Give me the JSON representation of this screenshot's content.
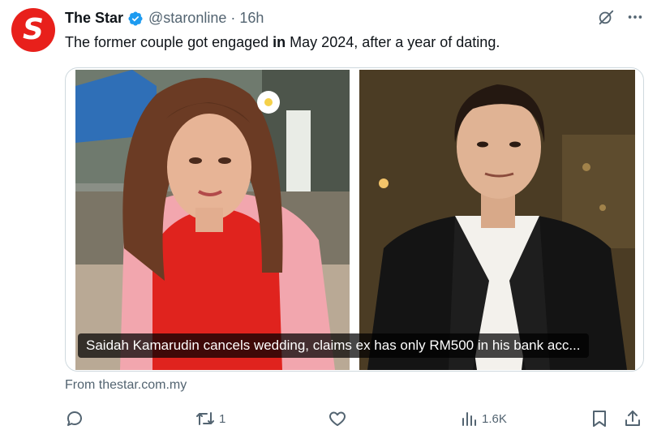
{
  "tweet": {
    "avatar_letter": "S",
    "author_name": "The Star",
    "handle": "@staronline",
    "separator": "·",
    "time": "16h",
    "text_before": "The former couple got engaged ",
    "text_bold": "in",
    "text_after": " May 2024, after a year of dating."
  },
  "card": {
    "caption": "Saidah Kamarudin cancels wedding, claims ex has only RM500 in his bank acc...",
    "source": "From thestar.com.my"
  },
  "actions": {
    "reply_count": "",
    "retweet_count": "1",
    "like_count": "",
    "views_count": "1.6K"
  },
  "colors": {
    "brand": "#e8201b",
    "verified": "#1d9bf0",
    "muted": "#536471"
  }
}
